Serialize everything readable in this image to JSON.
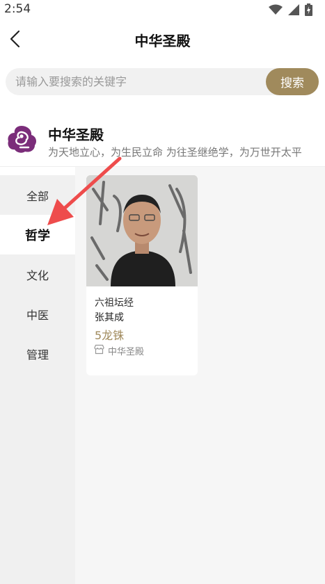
{
  "status_bar": {
    "time": "2:54"
  },
  "header": {
    "title": "中华圣殿"
  },
  "search": {
    "placeholder": "请输入要搜索的关键字",
    "button_label": "搜索"
  },
  "brand": {
    "name": "中华圣殿",
    "slogan": "为天地立心，为生民立命 为往圣继绝学，为万世开太平"
  },
  "categories": [
    {
      "label": "全部"
    },
    {
      "label": "哲学",
      "active": true
    },
    {
      "label": "文化"
    },
    {
      "label": "中医"
    },
    {
      "label": "管理"
    }
  ],
  "products": [
    {
      "title": "六祖坛经",
      "author": "张其成",
      "price": "5龙铢",
      "shop": "中华圣殿"
    }
  ],
  "colors": {
    "accent": "#a08a5c",
    "logo": "#7b2d7a",
    "arrow": "#ee4c4c"
  }
}
